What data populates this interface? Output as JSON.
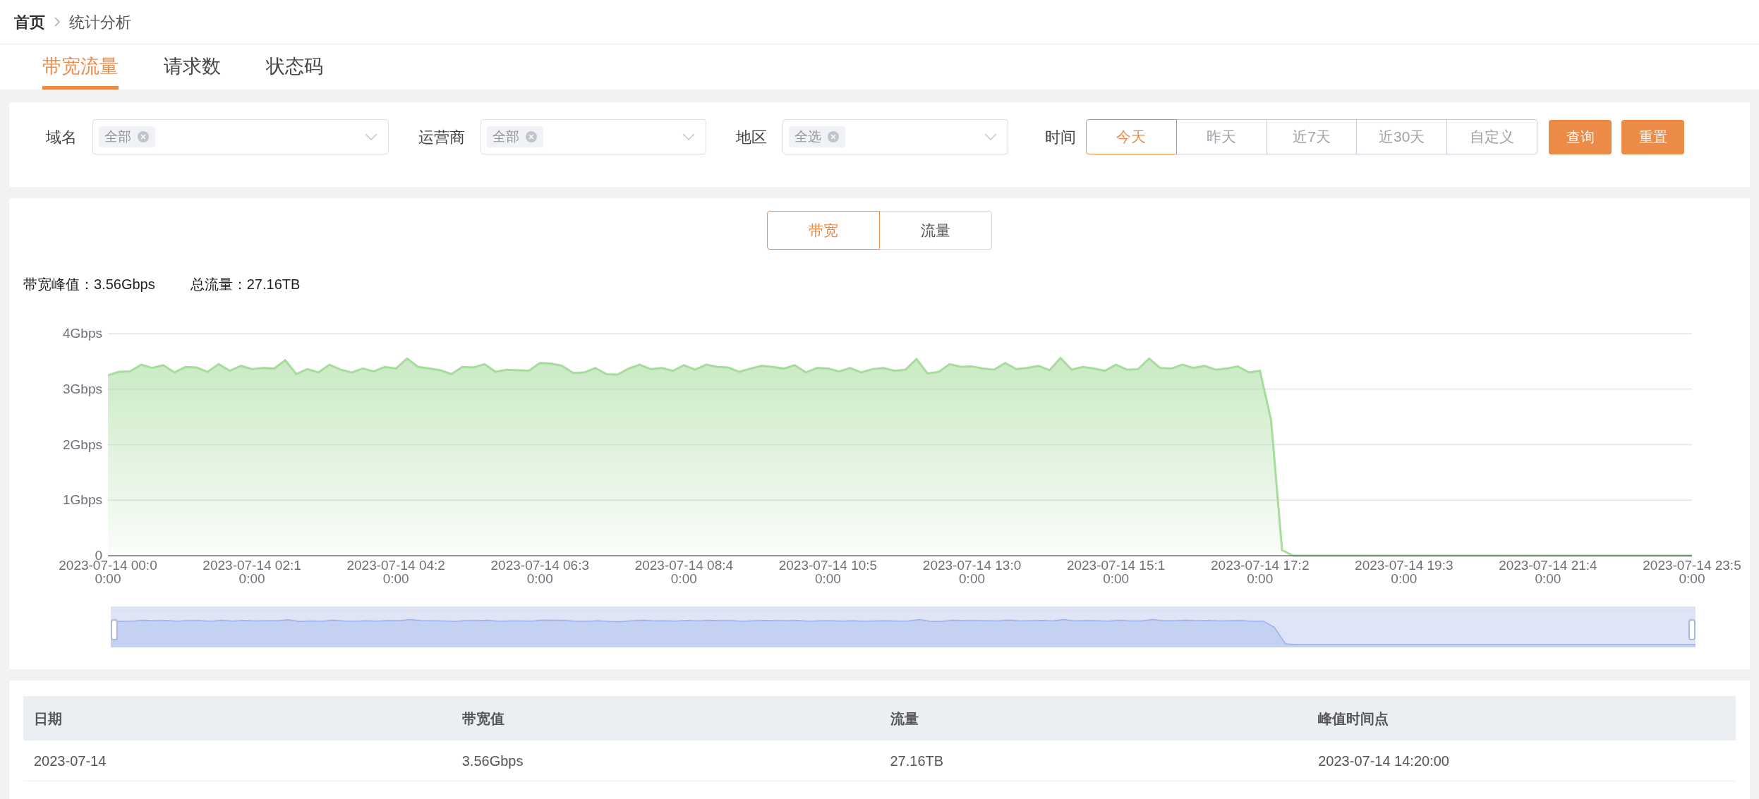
{
  "breadcrumb": [
    "首页",
    "统计分析"
  ],
  "tabs": [
    {
      "label": "带宽流量",
      "selected": true
    },
    {
      "label": "请求数",
      "selected": false
    },
    {
      "label": "状态码",
      "selected": false
    }
  ],
  "filters": [
    {
      "label": "域名",
      "tags": [
        "全部"
      ]
    },
    {
      "label": "运营商",
      "tags": [
        "全部"
      ]
    },
    {
      "label": "地区",
      "tags": [
        "全选"
      ]
    }
  ],
  "time": {
    "label": "时间",
    "options": [
      {
        "label": "今天",
        "selected": true
      },
      {
        "label": "昨天",
        "selected": false
      },
      {
        "label": "近7天",
        "selected": false
      },
      {
        "label": "近30天",
        "selected": false
      },
      {
        "label": "自定义",
        "selected": false
      }
    ]
  },
  "buttons": [
    "查询",
    "重置"
  ],
  "metric_toggle": [
    {
      "label": "带宽",
      "selected": true
    },
    {
      "label": "流量",
      "selected": false
    }
  ],
  "stats": [
    "带宽峰值：3.56Gbps",
    "总流量：27.16TB"
  ],
  "chart": {
    "chart_data": {
      "type": "area",
      "ylim": [
        0,
        4
      ],
      "grid": true,
      "yticks": [
        {
          "value": 0,
          "label": "0"
        },
        {
          "value": 1,
          "label": "1Gbps"
        },
        {
          "value": 2,
          "label": "2Gbps"
        },
        {
          "value": 3,
          "label": "3Gbps"
        },
        {
          "value": 4,
          "label": "4Gbps"
        }
      ],
      "categories": [
        "2023-07-14 00:00:00",
        null,
        null,
        null,
        null,
        null,
        null,
        null,
        null,
        null,
        null,
        null,
        null,
        "2023-07-14 02:10:00",
        null,
        null,
        null,
        null,
        null,
        null,
        null,
        null,
        null,
        null,
        null,
        null,
        "2023-07-14 04:20:00",
        null,
        null,
        null,
        null,
        null,
        null,
        null,
        null,
        null,
        null,
        null,
        null,
        "2023-07-14 06:30:00",
        null,
        null,
        null,
        null,
        null,
        null,
        null,
        null,
        null,
        null,
        null,
        null,
        "2023-07-14 08:40:00",
        null,
        null,
        null,
        null,
        null,
        null,
        null,
        null,
        null,
        null,
        null,
        null,
        "2023-07-14 10:50:00",
        null,
        null,
        null,
        null,
        null,
        null,
        null,
        null,
        null,
        null,
        null,
        null,
        "2023-07-14 13:00:00",
        null,
        null,
        null,
        null,
        null,
        null,
        null,
        null,
        null,
        null,
        null,
        null,
        "2023-07-14 15:10:00",
        null,
        null,
        null,
        null,
        null,
        null,
        null,
        null,
        null,
        null,
        null,
        null,
        "2023-07-14 17:20:00",
        null,
        null,
        null,
        null,
        null,
        null,
        null,
        null,
        null,
        null,
        null,
        null,
        "2023-07-14 19:30:00",
        null,
        null,
        null,
        null,
        null,
        null,
        null,
        null,
        null,
        null,
        null,
        null,
        "2023-07-14 21:40:00",
        null,
        null,
        null,
        null,
        null,
        null,
        null,
        null,
        null,
        null,
        null,
        null,
        "2023-07-14 23:50:00"
      ],
      "series": [
        {
          "color": "#a6dc9c",
          "values": [
            3.25,
            3.31,
            3.32,
            3.44,
            3.38,
            3.43,
            3.3,
            3.4,
            3.39,
            3.31,
            3.45,
            3.33,
            3.42,
            3.36,
            3.38,
            3.37,
            3.52,
            3.27,
            3.36,
            3.3,
            3.44,
            3.35,
            3.3,
            3.37,
            3.32,
            3.4,
            3.37,
            3.55,
            3.4,
            3.37,
            3.34,
            3.27,
            3.4,
            3.39,
            3.45,
            3.31,
            3.35,
            3.34,
            3.33,
            3.47,
            3.46,
            3.42,
            3.29,
            3.3,
            3.38,
            3.27,
            3.26,
            3.37,
            3.44,
            3.36,
            3.38,
            3.33,
            3.43,
            3.35,
            3.44,
            3.4,
            3.39,
            3.31,
            3.37,
            3.42,
            3.4,
            3.37,
            3.43,
            3.3,
            3.38,
            3.37,
            3.32,
            3.38,
            3.3,
            3.36,
            3.38,
            3.33,
            3.35,
            3.54,
            3.28,
            3.31,
            3.45,
            3.4,
            3.41,
            3.37,
            3.35,
            3.47,
            3.36,
            3.38,
            3.42,
            3.34,
            3.56,
            3.35,
            3.4,
            3.37,
            3.33,
            3.44,
            3.35,
            3.36,
            3.55,
            3.38,
            3.37,
            3.44,
            3.38,
            3.42,
            3.35,
            3.37,
            3.41,
            3.3,
            3.33,
            2.45,
            0.1,
            0,
            0,
            0,
            0,
            0,
            0,
            0,
            0,
            0,
            0,
            0,
            0,
            0,
            0,
            0,
            0,
            0,
            0,
            0,
            0,
            0,
            0,
            0,
            0,
            0,
            0,
            0,
            0,
            0,
            0,
            0,
            0,
            0,
            0,
            0,
            0,
            0
          ]
        }
      ]
    }
  },
  "zoom_slider": {
    "level": 1
  },
  "table": {
    "columns": [
      "日期",
      "带宽值",
      "流量",
      "峰值时间点"
    ],
    "rows": [
      [
        "2023-07-14",
        "3.56Gbps",
        "27.16TB",
        "2023-07-14 14:20:00"
      ]
    ]
  }
}
